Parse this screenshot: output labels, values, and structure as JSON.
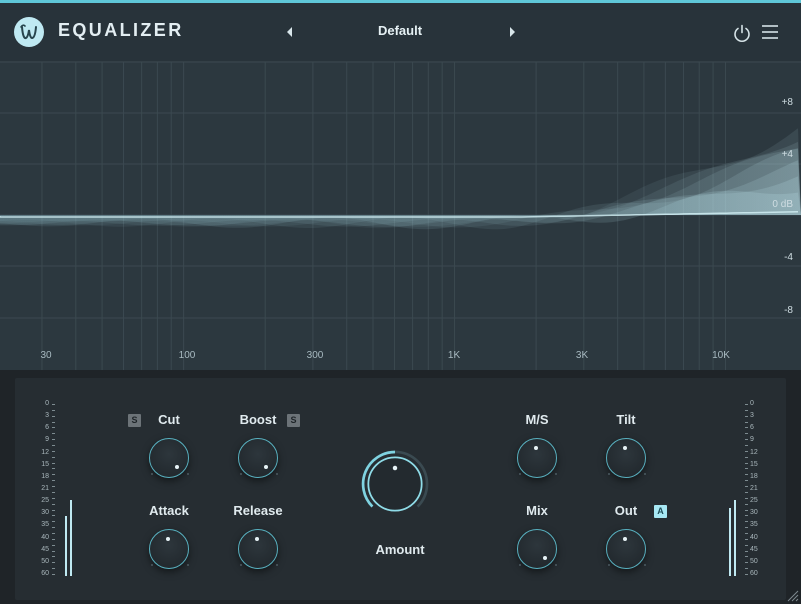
{
  "header": {
    "title": "EQUALIZER",
    "preset": "Default",
    "prev_icon": "chevron-left-icon",
    "next_icon": "chevron-right-icon",
    "power_icon": "power-icon",
    "menu_icon": "hamburger-menu-icon"
  },
  "graph": {
    "db_labels": [
      "+8",
      "+4",
      "0 dB",
      "-4",
      "-8"
    ],
    "freq_labels": [
      "30",
      "100",
      "300",
      "1K",
      "3K",
      "10K"
    ]
  },
  "meters": {
    "scale": [
      "0",
      "3",
      "6",
      "9",
      "12",
      "15",
      "18",
      "21",
      "25",
      "30",
      "35",
      "40",
      "45",
      "50",
      "60"
    ]
  },
  "controls": {
    "cut": {
      "label": "Cut",
      "solo": "S"
    },
    "boost": {
      "label": "Boost",
      "solo": "S"
    },
    "attack": {
      "label": "Attack"
    },
    "release": {
      "label": "Release"
    },
    "amount": {
      "label": "Amount"
    },
    "ms": {
      "label": "M/S"
    },
    "tilt": {
      "label": "Tilt"
    },
    "mix": {
      "label": "Mix"
    },
    "out": {
      "label": "Out",
      "auto": "A"
    }
  },
  "colors": {
    "accent": "#5fc7d8",
    "background": "#202529",
    "graph_bg": "#2c383f"
  }
}
